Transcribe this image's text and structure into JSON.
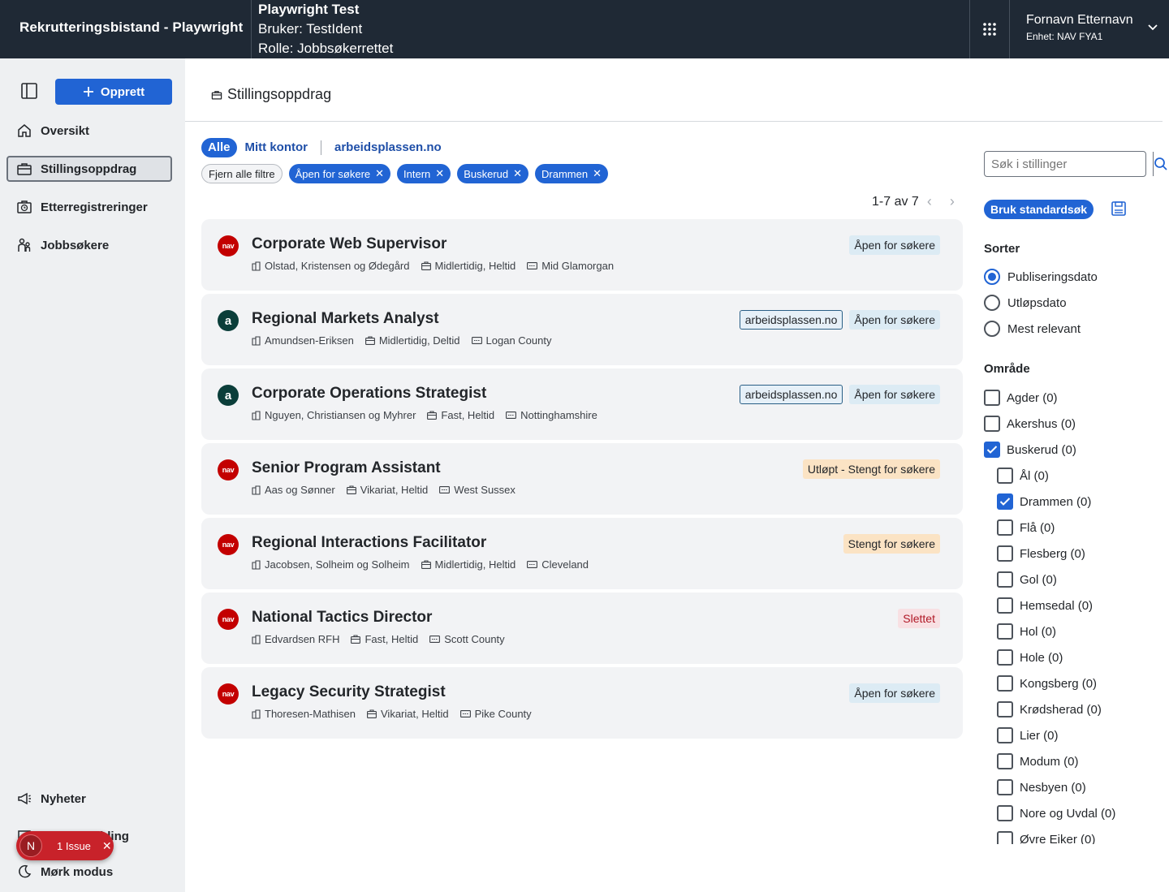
{
  "header": {
    "app_title": "Rekrutteringsbistand - Playwright",
    "test_title": "Playwright Test",
    "test_user": "Bruker: TestIdent",
    "test_role": "Rolle: Jobbsøkerrettet",
    "user_name": "Fornavn Etternavn",
    "user_unit": "Enhet: NAV FYA1"
  },
  "sidebar": {
    "create_label": "Opprett",
    "items": [
      {
        "label": "Oversikt"
      },
      {
        "label": "Stillingsoppdrag"
      },
      {
        "label": "Etterregistreringer"
      },
      {
        "label": "Jobbsøkere"
      }
    ],
    "bottom": [
      {
        "label": "Nyheter"
      },
      {
        "label": "Tilbakemelding"
      },
      {
        "label": "Mørk modus"
      }
    ],
    "issue_badge": {
      "letter": "N",
      "label": "1 Issue"
    }
  },
  "page": {
    "title": "Stillingsoppdrag",
    "tabs": [
      {
        "label": "Alle",
        "active": true
      },
      {
        "label": "Mitt kontor",
        "active": false
      },
      {
        "label": "arbeidsplassen.no",
        "active": false
      }
    ],
    "clear_filters": "Fjern alle filtre",
    "chips": [
      "Åpen for søkere",
      "Intern",
      "Buskerud",
      "Drammen"
    ],
    "pager": "1-7 av 7"
  },
  "cards": [
    {
      "title": "Corporate Web Supervisor",
      "employer": "Olstad, Kristensen og Ødegård",
      "type": "Midlertidig, Heltid",
      "location": "Mid Glamorgan",
      "source": "nav",
      "tags": [
        {
          "text": "Åpen for søkere",
          "kind": "open"
        }
      ]
    },
    {
      "title": "Regional Markets Analyst",
      "employer": "Amundsen-Eriksen",
      "type": "Midlertidig, Deltid",
      "location": "Logan County",
      "source": "arb",
      "tags": [
        {
          "text": "arbeidsplassen.no",
          "kind": "arb"
        },
        {
          "text": "Åpen for søkere",
          "kind": "open"
        }
      ]
    },
    {
      "title": "Corporate Operations Strategist",
      "employer": "Nguyen, Christiansen og Myhrer",
      "type": "Fast, Heltid",
      "location": "Nottinghamshire",
      "source": "arb",
      "tags": [
        {
          "text": "arbeidsplassen.no",
          "kind": "arb"
        },
        {
          "text": "Åpen for søkere",
          "kind": "open"
        }
      ]
    },
    {
      "title": "Senior Program Assistant",
      "employer": "Aas og Sønner",
      "type": "Vikariat, Heltid",
      "location": "West Sussex",
      "source": "nav",
      "tags": [
        {
          "text": "Utløpt - Stengt for søkere",
          "kind": "warn"
        }
      ]
    },
    {
      "title": "Regional Interactions Facilitator",
      "employer": "Jacobsen, Solheim og Solheim",
      "type": "Midlertidig, Heltid",
      "location": "Cleveland",
      "source": "nav",
      "tags": [
        {
          "text": "Stengt for søkere",
          "kind": "warn"
        }
      ]
    },
    {
      "title": "National Tactics Director",
      "employer": "Edvardsen RFH",
      "type": "Fast, Heltid",
      "location": "Scott County",
      "source": "nav",
      "tags": [
        {
          "text": "Slettet",
          "kind": "del"
        }
      ]
    },
    {
      "title": "Legacy Security Strategist",
      "employer": "Thoresen-Mathisen",
      "type": "Vikariat, Heltid",
      "location": "Pike County",
      "source": "nav",
      "tags": [
        {
          "text": "Åpen for søkere",
          "kind": "open"
        }
      ]
    }
  ],
  "filters": {
    "search_placeholder": "Søk i stillinger",
    "standard_search": "Bruk standardsøk",
    "sort_label": "Sorter",
    "sort_options": [
      {
        "label": "Publiseringsdato",
        "checked": true
      },
      {
        "label": "Utløpsdato",
        "checked": false
      },
      {
        "label": "Mest relevant",
        "checked": false
      }
    ],
    "area_label": "Område",
    "areas": [
      {
        "label": "Agder (0)",
        "checked": false,
        "level": 0
      },
      {
        "label": "Akershus (0)",
        "checked": false,
        "level": 0
      },
      {
        "label": "Buskerud (0)",
        "checked": true,
        "level": 0
      },
      {
        "label": "Ål (0)",
        "checked": false,
        "level": 1
      },
      {
        "label": "Drammen (0)",
        "checked": true,
        "level": 1
      },
      {
        "label": "Flå (0)",
        "checked": false,
        "level": 1
      },
      {
        "label": "Flesberg (0)",
        "checked": false,
        "level": 1
      },
      {
        "label": "Gol (0)",
        "checked": false,
        "level": 1
      },
      {
        "label": "Hemsedal (0)",
        "checked": false,
        "level": 1
      },
      {
        "label": "Hol (0)",
        "checked": false,
        "level": 1
      },
      {
        "label": "Hole (0)",
        "checked": false,
        "level": 1
      },
      {
        "label": "Kongsberg (0)",
        "checked": false,
        "level": 1
      },
      {
        "label": "Krødsherad (0)",
        "checked": false,
        "level": 1
      },
      {
        "label": "Lier (0)",
        "checked": false,
        "level": 1
      },
      {
        "label": "Modum (0)",
        "checked": false,
        "level": 1
      },
      {
        "label": "Nesbyen (0)",
        "checked": false,
        "level": 1
      },
      {
        "label": "Nore og Uvdal (0)",
        "checked": false,
        "level": 1
      },
      {
        "label": "Øvre Eiker (0)",
        "checked": false,
        "level": 1
      }
    ]
  }
}
